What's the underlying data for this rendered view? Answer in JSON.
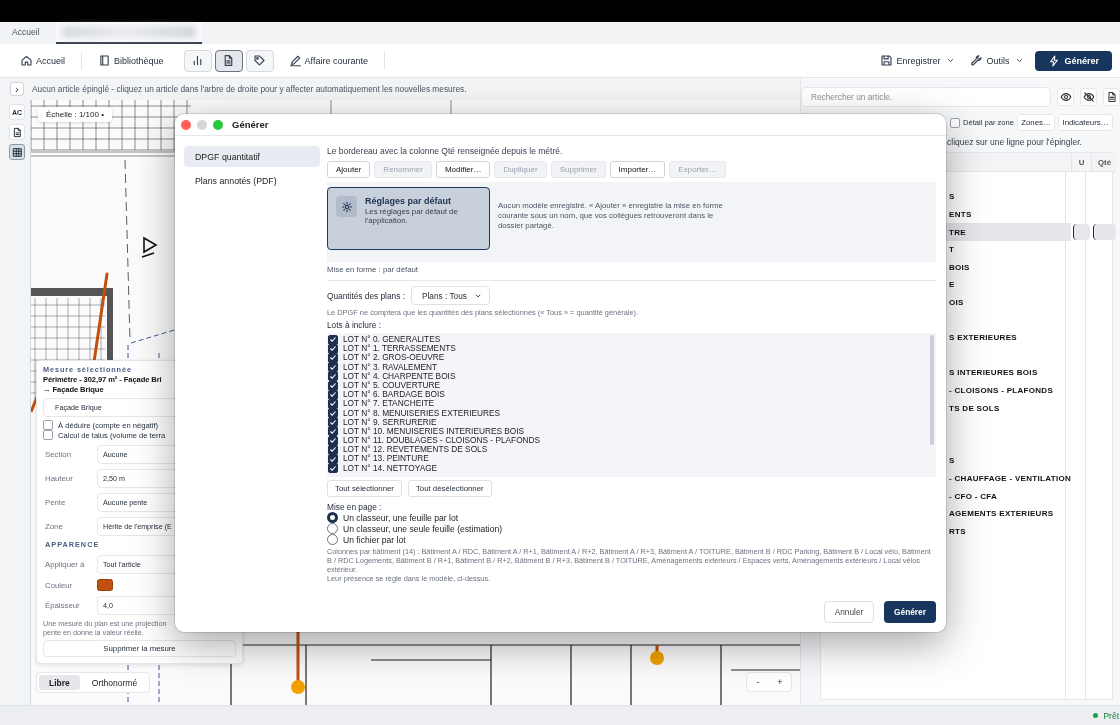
{
  "tabs": [
    {
      "kind": "text",
      "label": "Accueil",
      "selected": false
    },
    {
      "kind": "redacted",
      "selected": true
    }
  ],
  "toolbar": {
    "left": [
      {
        "kind": "text",
        "label": "Accueil"
      },
      {
        "kind": "text",
        "label": "Bibliothèque"
      },
      {
        "kind": "toggle",
        "selected": false
      },
      {
        "kind": "toggle",
        "selected": true
      },
      {
        "kind": "toggle",
        "selected": false
      },
      {
        "kind": "text",
        "label": "Affaire courante"
      }
    ],
    "right": [
      {
        "kind": "menu",
        "label": "Enregistrer"
      },
      {
        "kind": "menu",
        "label": "Outils"
      },
      {
        "kind": "primary",
        "label": "Générer"
      }
    ]
  },
  "info_bar": {
    "toggle": "›",
    "message": "Aucun article épinglé - cliquez un article dans l'arbre de droite pour y affecter automatiquement les nouvelles mesures."
  },
  "rail": [
    {
      "kind": "text",
      "label": "AC",
      "selected": false
    },
    {
      "kind": "icon",
      "selected": false
    },
    {
      "kind": "icon",
      "selected": true
    }
  ],
  "canvas": {
    "scale": "Échelle : 1/100 •",
    "zoom_out": "-",
    "zoom_in": "+"
  },
  "measure_panel": {
    "title": "Mesure sélectionnée",
    "summary": "Périmètre - 302,97 m² - Façade Bri",
    "target": "→ Façade Brique",
    "article": "Façade Brique",
    "options": [
      {
        "label": "À déduire (compte en négatif)",
        "checked": false
      },
      {
        "label": "Calcul de talus (volume de terra",
        "checked": false
      }
    ],
    "fields": [
      {
        "label": "Section",
        "value": "Aucune"
      },
      {
        "label": "Hauteur",
        "value": "2,50 m"
      },
      {
        "label": "Pente",
        "value": "Aucune pente"
      },
      {
        "label": "Zone",
        "value": "Hérite de l'emprise (E"
      }
    ],
    "appearance_title": "APPARENCE",
    "appearance": [
      {
        "kind": "field",
        "label": "Appliquer à",
        "value": "Tout l'article"
      },
      {
        "kind": "swatch",
        "label": "Couleur",
        "color": "#c2510f"
      },
      {
        "kind": "field",
        "label": "Épaisseur",
        "value": "4,0"
      }
    ],
    "note_lines": [
      "Une mesure du plan est une projection",
      "pente en donne la valeur réelle."
    ],
    "delete": "Supprimer la mesure"
  },
  "snap_modes": [
    {
      "label": "Libre",
      "selected": true
    },
    {
      "label": "Orthonormé",
      "selected": false
    }
  ],
  "right_panel": {
    "search": {
      "placeholder": "Rechercher un article."
    },
    "detail_by_zone": {
      "label": "Détail par zone",
      "checked": false
    },
    "buttons": [
      "Zones…",
      "Indicateurs…"
    ],
    "hint": "cliquez sur une ligne pour l'épingler.",
    "columns": [
      {
        "label": "U"
      },
      {
        "label": "Qté"
      }
    ],
    "rows": [
      {
        "selected": false
      },
      {
        "text": "S",
        "selected": false
      },
      {
        "text": "ENTS",
        "selected": false
      },
      {
        "text": "TRE",
        "selected": true
      },
      {
        "text": "T",
        "selected": false
      },
      {
        "text": "BOIS",
        "selected": false
      },
      {
        "text": "E",
        "selected": false
      },
      {
        "text": "OIS",
        "selected": false
      },
      {
        "selected": false
      },
      {
        "text": "S EXTERIEURES",
        "selected": false
      },
      {
        "selected": false
      },
      {
        "text": "S INTERIEURES BOIS",
        "selected": false
      },
      {
        "text": "- CLOISONS - PLAFONDS",
        "selected": false
      },
      {
        "text": "TS DE SOLS",
        "selected": false
      },
      {
        "selected": false
      },
      {
        "selected": false
      },
      {
        "text": "S",
        "selected": false
      },
      {
        "text": "- CHAUFFAGE - VENTILATION",
        "selected": false
      },
      {
        "text": "- CFO - CFA",
        "selected": false
      },
      {
        "text": "AGEMENTS EXTERIEURS",
        "selected": false
      },
      {
        "text": "RTS",
        "selected": false
      }
    ]
  },
  "dialog": {
    "title": "Générer",
    "nav": [
      {
        "label": "DPGF quantitatif",
        "selected": true
      },
      {
        "label": "Plans annotés (PDF)",
        "selected": false
      }
    ],
    "description": "Le bordereau avec la colonne Qté renseignée depuis le métré.",
    "actions": [
      {
        "label": "Ajouter",
        "disabled": false
      },
      {
        "label": "Renommer",
        "disabled": true
      },
      {
        "label": "Modifier…",
        "disabled": false
      },
      {
        "label": "Dupliquer",
        "disabled": true
      },
      {
        "label": "Supprimer",
        "disabled": true
      },
      {
        "label": "Importer…",
        "disabled": false
      },
      {
        "label": "Exporter…",
        "disabled": true
      }
    ],
    "templates": [
      {
        "title": "Réglages par défaut",
        "description": "Les réglages par défaut de l'application.",
        "selected": true
      }
    ],
    "templates_note": "Aucun modèle enregistré. « Ajouter » enregistre la mise en forme courante sous un nom, que vos collègues retrouveront dans le dossier partagé.",
    "format_status": "Mise en forme : par défaut",
    "plans": {
      "label": "Quantités des plans :",
      "value": "Plans : Tous",
      "hint": "Le DPGF ne comptera que les quantités des plans sélectionnés (« Tous » = quantité générale)."
    },
    "lots": {
      "label": "Lots à inclure :",
      "items": [
        {
          "label": "LOT N° 0. GENERALITES",
          "checked": true
        },
        {
          "label": "LOT N° 1. TERRASSEMENTS",
          "checked": true
        },
        {
          "label": "LOT N° 2. GROS-OEUVRE",
          "checked": true
        },
        {
          "label": "LOT N° 3. RAVALEMENT",
          "checked": true
        },
        {
          "label": "LOT N° 4. CHARPENTE BOIS",
          "checked": true
        },
        {
          "label": "LOT N° 5. COUVERTURE",
          "checked": true
        },
        {
          "label": "LOT N° 6. BARDAGE BOIS",
          "checked": true
        },
        {
          "label": "LOT N° 7. ETANCHEITE",
          "checked": true
        },
        {
          "label": "LOT N° 8. MENUISERIES EXTERIEURES",
          "checked": true
        },
        {
          "label": "LOT N° 9. SERRURERIE",
          "checked": true
        },
        {
          "label": "LOT N° 10. MENUISERIES INTERIEURES BOIS",
          "checked": true
        },
        {
          "label": "LOT N° 11. DOUBLAGES - CLOISONS - PLAFONDS",
          "checked": true
        },
        {
          "label": "LOT N° 12. REVETEMENTS DE SOLS",
          "checked": true
        },
        {
          "label": "LOT N° 13. PEINTURE",
          "checked": true
        },
        {
          "label": "LOT N° 14. NETTOYAGE",
          "checked": true
        }
      ]
    },
    "select_all": "Tout sélectionner",
    "deselect_all": "Tout désélectionner",
    "layout": {
      "label": "Mise en page :",
      "options": [
        {
          "label": "Un classeur, une feuille par lot",
          "selected": true
        },
        {
          "label": "Un classeur, une seule feuille (estimation)",
          "selected": false
        },
        {
          "label": "Un fichier par lot",
          "selected": false
        }
      ]
    },
    "columns_note": "Colonnes par bâtiment (14) : Bâtiment A / RDC, Bâtiment A / R+1, Bâtiment A / R+2, Bâtiment A / R+3, Bâtiment A / TOITURE, Bâtiment B / RDC Parking, Bâtiment B / Local vélo, Bâtiment B / RDC Logements, Bâtiment B / R+1, Bâtiment B / R+2, Bâtiment B / R+3, Bâtiment B / TOITURE, Aménagements extérieurs / Espaces verts, Aménagements extérieurs / Local vélos extérieur.",
    "columns_footer": "Leur présence se règle dans le modèle, ci-dessus.",
    "cancel": "Annuler",
    "confirm": "Générer"
  },
  "status": {
    "text": "Prêt"
  }
}
